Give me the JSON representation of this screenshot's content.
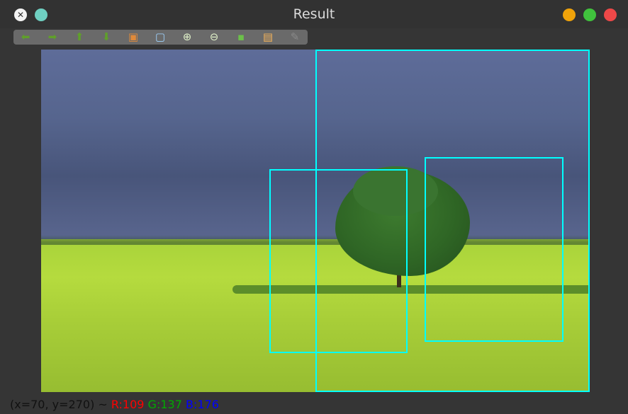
{
  "window": {
    "title": "Result",
    "app_icon_glyph": "✕"
  },
  "toolbar": {
    "buttons": [
      {
        "name": "back-arrow-icon",
        "glyph": "⬅",
        "color": "#5fa02a"
      },
      {
        "name": "forward-arrow-icon",
        "glyph": "➡",
        "color": "#5fa02a"
      },
      {
        "name": "up-arrow-icon",
        "glyph": "⬆",
        "color": "#5fa02a"
      },
      {
        "name": "down-arrow-icon",
        "glyph": "⬇",
        "color": "#5fa02a"
      },
      {
        "name": "image-icon",
        "glyph": "▣",
        "color": "#e08a3a"
      },
      {
        "name": "zoom-fit-icon",
        "glyph": "▢",
        "color": "#9fd4ff"
      },
      {
        "name": "zoom-in-icon",
        "glyph": "⊕",
        "color": "#dff0c8"
      },
      {
        "name": "zoom-out-icon",
        "glyph": "⊖",
        "color": "#dff0c8"
      },
      {
        "name": "save-icon",
        "glyph": "▪",
        "color": "#6cc04a"
      },
      {
        "name": "clipboard-icon",
        "glyph": "▤",
        "color": "#f2b25a"
      },
      {
        "name": "properties-icon",
        "glyph": "✎",
        "color": "#8a8a8a"
      }
    ]
  },
  "status": {
    "coords": "(x=70, y=270) ~",
    "r": "R:109",
    "g": "G:137",
    "b": "B:176"
  },
  "colors": {
    "bbox": "#00ffff",
    "titlebar": "#323232",
    "background": "#353535"
  }
}
